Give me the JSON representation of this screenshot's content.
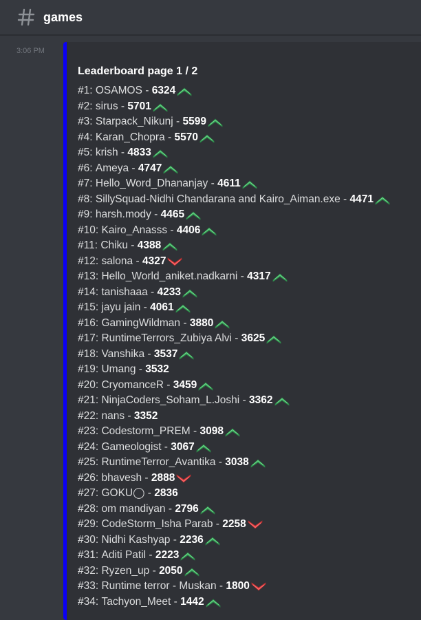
{
  "header": {
    "channel_name": "games"
  },
  "message": {
    "timestamp": "3:06 PM",
    "embed": {
      "accent_color": "#0b00f5",
      "title": "Leaderboard page 1 / 2",
      "rows": [
        {
          "rank": "#1:",
          "name": "OSAMOS",
          "score": "6324",
          "trend": "up"
        },
        {
          "rank": "#2:",
          "name": "sirus",
          "score": "5701",
          "trend": "up"
        },
        {
          "rank": "#3:",
          "name": "Starpack_Nikunj",
          "score": "5599",
          "trend": "up"
        },
        {
          "rank": "#4:",
          "name": "Karan_Chopra",
          "score": "5570",
          "trend": "up"
        },
        {
          "rank": "#5:",
          "name": "krish",
          "score": "4833",
          "trend": "up"
        },
        {
          "rank": "#6:",
          "name": "Ameya",
          "score": "4747",
          "trend": "up"
        },
        {
          "rank": "#7:",
          "name": "Hello_Word_Dhananjay",
          "score": "4611",
          "trend": "up"
        },
        {
          "rank": "#8:",
          "name": "SillySquad-Nidhi Chandarana and Kairo_Aiman.exe",
          "score": "4471",
          "trend": "up"
        },
        {
          "rank": "#9:",
          "name": "harsh.mody",
          "score": "4465",
          "trend": "up"
        },
        {
          "rank": "#10:",
          "name": "Kairo_Anasss",
          "score": "4406",
          "trend": "up"
        },
        {
          "rank": "#11:",
          "name": "Chiku",
          "score": "4388",
          "trend": "up"
        },
        {
          "rank": "#12:",
          "name": "salona",
          "score": "4327",
          "trend": "down"
        },
        {
          "rank": "#13:",
          "name": "Hello_World_aniket.nadkarni",
          "score": "4317",
          "trend": "up"
        },
        {
          "rank": "#14:",
          "name": "tanishaaa",
          "score": "4233",
          "trend": "up"
        },
        {
          "rank": "#15:",
          "name": "jayu jain",
          "score": "4061",
          "trend": "up"
        },
        {
          "rank": "#16:",
          "name": "GamingWildman",
          "score": "3880",
          "trend": "up"
        },
        {
          "rank": "#17:",
          "name": "RuntimeTerrors_Zubiya Alvi",
          "score": "3625",
          "trend": "up"
        },
        {
          "rank": "#18:",
          "name": "Vanshika",
          "score": "3537",
          "trend": "up"
        },
        {
          "rank": "#19:",
          "name": "Umang",
          "score": "3532",
          "trend": "none"
        },
        {
          "rank": "#20:",
          "name": "CryomanceR",
          "score": "3459",
          "trend": "up"
        },
        {
          "rank": "#21:",
          "name": "NinjaCoders_Soham_L.Joshi",
          "score": "3362",
          "trend": "up"
        },
        {
          "rank": "#22:",
          "name": "nans",
          "score": "3352",
          "trend": "none"
        },
        {
          "rank": "#23:",
          "name": "Codestorm_PREM",
          "score": "3098",
          "trend": "up"
        },
        {
          "rank": "#24:",
          "name": "Gameologist",
          "score": "3067",
          "trend": "up"
        },
        {
          "rank": "#25:",
          "name": "RuntimeTerror_Avantika",
          "score": "3038",
          "trend": "up"
        },
        {
          "rank": "#26:",
          "name": "bhavesh",
          "score": "2888",
          "trend": "down"
        },
        {
          "rank": "#27:",
          "name": "GOKU◯",
          "score": "2836",
          "trend": "none"
        },
        {
          "rank": "#28:",
          "name": "om mandiyan",
          "score": "2796",
          "trend": "up"
        },
        {
          "rank": "#29:",
          "name": "CodeStorm_Isha Parab",
          "score": "2258",
          "trend": "down"
        },
        {
          "rank": "#30:",
          "name": "Nidhi Kashyap",
          "score": "2236",
          "trend": "up"
        },
        {
          "rank": "#31:",
          "name": "Aditi Patil",
          "score": "2223",
          "trend": "up"
        },
        {
          "rank": "#32:",
          "name": "Ryzen_up",
          "score": "2050",
          "trend": "up"
        },
        {
          "rank": "#33:",
          "name": "Runtime terror - Muskan",
          "score": "1800",
          "trend": "down"
        },
        {
          "rank": "#34:",
          "name": "Tachyon_Meet",
          "score": "1442",
          "trend": "up"
        }
      ]
    }
  },
  "colors": {
    "background": "#36393f",
    "embed_background": "#2f3136",
    "up": "#3ba55c",
    "down": "#ed4245"
  },
  "icons": {
    "channel": "hash-icon",
    "up": "chevron-up-icon",
    "down": "chevron-down-icon"
  }
}
